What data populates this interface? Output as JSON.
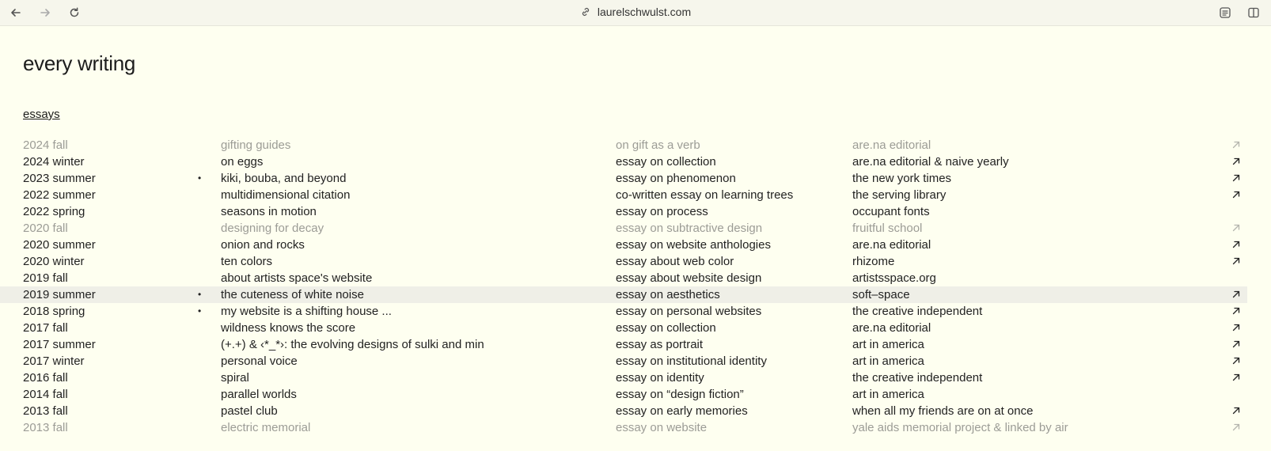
{
  "browser": {
    "url": "laurelschwulst.com",
    "icons": {
      "back": "back-arrow-icon",
      "forward": "forward-arrow-icon",
      "reload": "reload-icon",
      "link": "link-icon",
      "reader": "reader-mode-icon",
      "sidebar": "sidebar-icon"
    }
  },
  "page": {
    "title": "every writing",
    "section": "essays"
  },
  "colors": {
    "background": "#fefff0",
    "text": "#222222",
    "dim_text": "#9c9c96",
    "highlight_row": "#efefe7"
  },
  "essays": [
    {
      "date": "2024 fall",
      "dot": false,
      "title": "gifting guides",
      "kind": "on gift as a verb",
      "publisher": "are.na editorial",
      "arrow": true,
      "dim": true
    },
    {
      "date": "2024 winter",
      "dot": false,
      "title": "on eggs",
      "kind": "essay on collection",
      "publisher": "are.na editorial & naive yearly",
      "arrow": true,
      "dim": false
    },
    {
      "date": "2023 summer",
      "dot": true,
      "title": "kiki, bouba, and beyond",
      "kind": "essay on phenomenon",
      "publisher": "the new york times",
      "arrow": true,
      "dim": false
    },
    {
      "date": "2022 summer",
      "dot": false,
      "title": "multidimensional citation",
      "kind": "co-written essay on learning trees",
      "publisher": "the serving library",
      "arrow": true,
      "dim": false
    },
    {
      "date": "2022 spring",
      "dot": false,
      "title": "seasons in motion",
      "kind": "essay on process",
      "publisher": "occupant fonts",
      "arrow": false,
      "dim": false
    },
    {
      "date": "2020 fall",
      "dot": false,
      "title": "designing for decay",
      "kind": "essay on subtractive design",
      "publisher": "fruitful school",
      "arrow": true,
      "dim": true
    },
    {
      "date": "2020 summer",
      "dot": false,
      "title": "onion and rocks",
      "kind": "essay on website anthologies",
      "publisher": "are.na editorial",
      "arrow": true,
      "dim": false
    },
    {
      "date": "2020 winter",
      "dot": false,
      "title": "ten colors",
      "kind": "essay about web color",
      "publisher": "rhizome",
      "arrow": true,
      "dim": false
    },
    {
      "date": "2019 fall",
      "dot": false,
      "title": "about artists space's website",
      "kind": "essay about website design",
      "publisher": "artistsspace.org",
      "arrow": false,
      "dim": false
    },
    {
      "date": "2019 summer",
      "dot": true,
      "title": "the cuteness of white noise",
      "kind": "essay on aesthetics",
      "publisher": "soft–space",
      "arrow": true,
      "dim": false,
      "highlight": true
    },
    {
      "date": "2018 spring",
      "dot": true,
      "title": "my website is a shifting house ...",
      "kind": "essay on personal websites",
      "publisher": "the creative independent",
      "arrow": true,
      "dim": false
    },
    {
      "date": "2017 fall",
      "dot": false,
      "title": "wildness knows the score",
      "kind": "essay on collection",
      "publisher": "are.na editorial",
      "arrow": true,
      "dim": false
    },
    {
      "date": "2017 summer",
      "dot": false,
      "title": "(+.+) & ‹*_*›: the evolving designs of sulki and min",
      "kind": "essay as portrait",
      "publisher": "art in america",
      "arrow": true,
      "dim": false
    },
    {
      "date": "2017 winter",
      "dot": false,
      "title": "personal voice",
      "kind": "essay on institutional identity",
      "publisher": "art in america",
      "arrow": true,
      "dim": false
    },
    {
      "date": "2016 fall",
      "dot": false,
      "title": "spiral",
      "kind": "essay on identity",
      "publisher": "the creative independent",
      "arrow": true,
      "dim": false
    },
    {
      "date": "2014 fall",
      "dot": false,
      "title": "parallel worlds",
      "kind": "essay on “design fiction”",
      "publisher": "art in america",
      "arrow": false,
      "dim": false
    },
    {
      "date": "2013 fall",
      "dot": false,
      "title": "pastel club",
      "kind": "essay on early memories",
      "publisher": "when all my friends are on at once",
      "arrow": true,
      "dim": false
    },
    {
      "date": "2013 fall",
      "dot": false,
      "title": "electric memorial",
      "kind": "essay on website",
      "publisher": "yale aids memorial project & linked by air",
      "arrow": true,
      "dim": true
    }
  ]
}
